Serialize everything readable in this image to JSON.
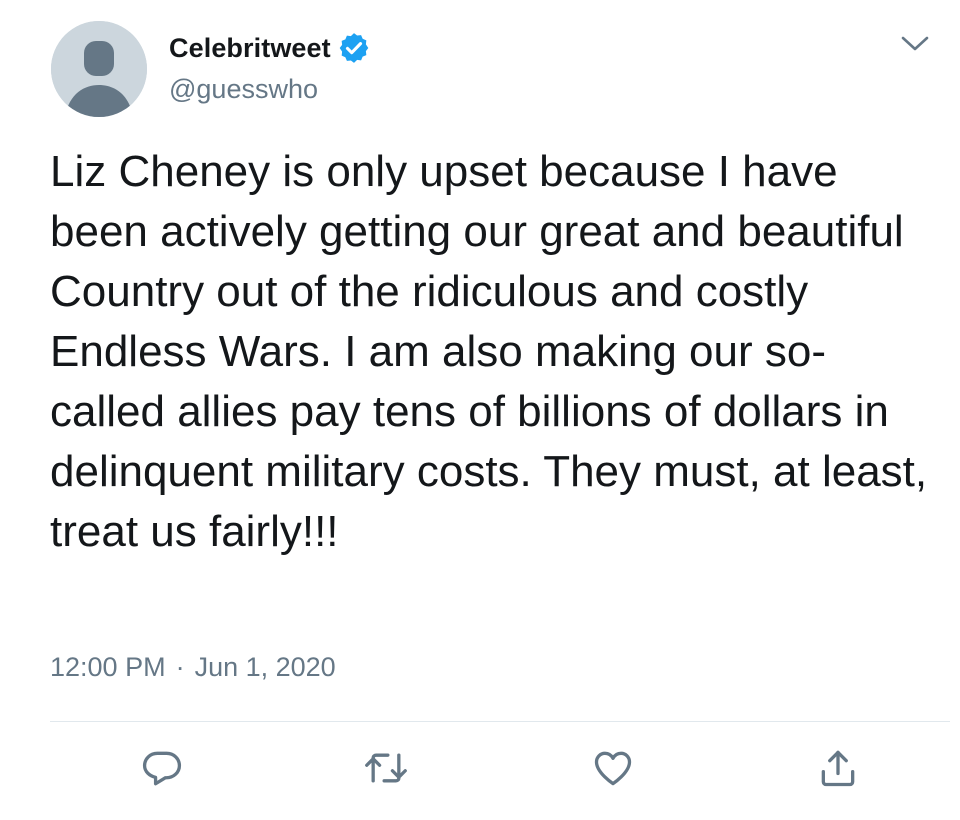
{
  "tweet": {
    "author": {
      "display_name": "Celebritweet",
      "handle": "@guesswho",
      "verified": true,
      "avatar_icon": "default-profile-avatar"
    },
    "text": "Liz Cheney is only upset because I have been actively getting our great and beautiful Country out of the ridiculous and costly Endless Wars. I am also making our so-called allies pay tens of billions of dollars in delinquent military costs. They must, at least, treat us fairly!!!",
    "time": "12:00 PM",
    "separator": "·",
    "date": "Jun 1, 2020",
    "menu_icon": "chevron-down-icon",
    "actions": [
      {
        "name": "reply",
        "icon": "reply-icon"
      },
      {
        "name": "retweet",
        "icon": "retweet-icon"
      },
      {
        "name": "like",
        "icon": "heart-icon"
      },
      {
        "name": "share",
        "icon": "share-icon"
      }
    ]
  },
  "colors": {
    "text_primary": "#14171a",
    "text_secondary": "#657786",
    "verified_blue": "#1da1f2",
    "divider": "#e1e8ed",
    "avatar_bg": "#ccd6dd",
    "avatar_figure": "#6b7c8a"
  }
}
